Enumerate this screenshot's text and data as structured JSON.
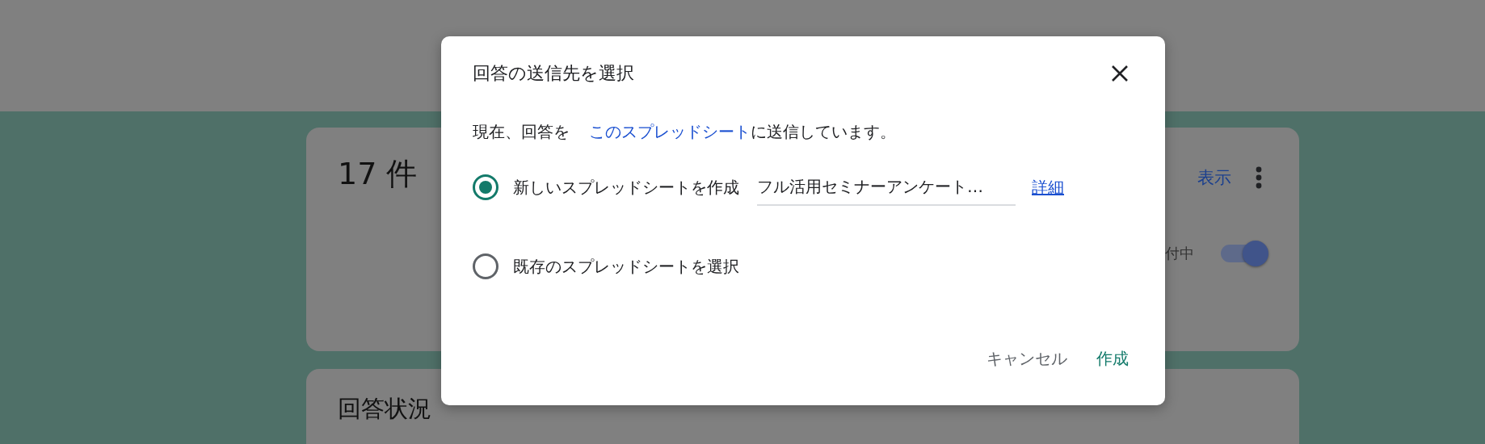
{
  "summary_card": {
    "title": "17 件",
    "view_link": "表示",
    "accepting_label": "付中",
    "accepting": {
      "on": true
    }
  },
  "status_card": {
    "title": "回答状況"
  },
  "dialog": {
    "title": "回答の送信先を選択",
    "description_prefix": "現在、回答を",
    "description_link": "このスプレッドシート",
    "description_suffix": "に送信しています。",
    "options": [
      {
        "kind": "new",
        "label": "新しいスプレッドシートを作成",
        "selected": true,
        "field_value": "フル活用セミナーアンケート…",
        "link": "詳細"
      },
      {
        "kind": "existing",
        "label": "既存のスプレッドシートを選択",
        "selected": false
      }
    ],
    "buttons": [
      {
        "kind": "cancel",
        "label": "キャンセル"
      },
      {
        "kind": "confirm",
        "label": "作成"
      }
    ]
  }
}
